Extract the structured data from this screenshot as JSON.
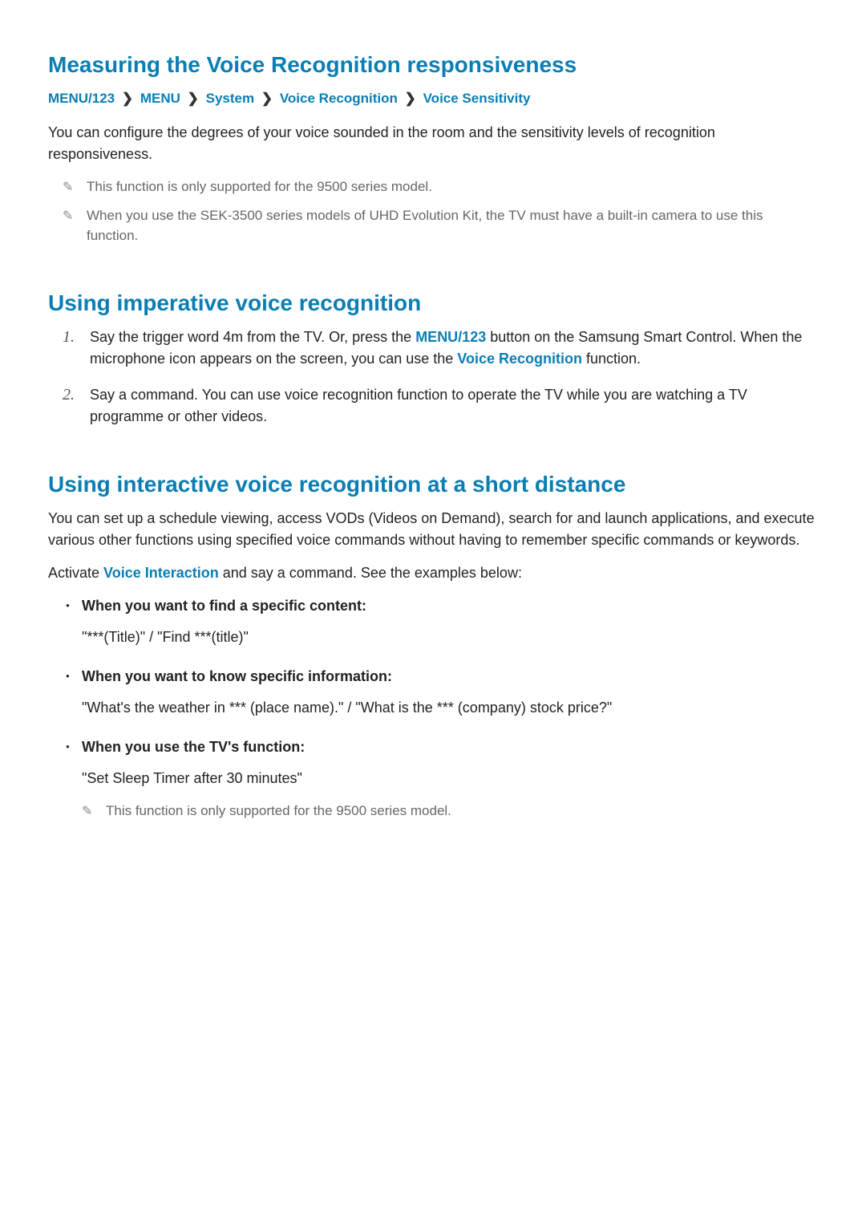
{
  "section1": {
    "title": "Measuring the Voice Recognition responsiveness",
    "breadcrumb": [
      "MENU/123",
      "MENU",
      "System",
      "Voice Recognition",
      "Voice Sensitivity"
    ],
    "intro": "You can configure the degrees of your voice sounded in the room and the sensitivity levels of recognition responsiveness.",
    "notes": [
      "This function is only supported for the 9500 series model.",
      "When you use the SEK-3500 series models of UHD Evolution Kit, the TV must have a built-in camera to use this function."
    ]
  },
  "section2": {
    "title": "Using imperative voice recognition",
    "steps": [
      {
        "num": "1.",
        "pre": "Say the trigger word 4m from the TV. Or, press the ",
        "link1": "MENU/123",
        "mid": " button on the Samsung Smart Control. When the microphone icon appears on the screen, you can use the ",
        "link2": "Voice Recognition",
        "post": " function."
      },
      {
        "num": "2.",
        "text": "Say a command. You can use voice recognition function to operate the TV while you are watching a TV programme or other videos."
      }
    ]
  },
  "section3": {
    "title": "Using interactive voice recognition at a short distance",
    "intro": "You can set up a schedule viewing, access VODs (Videos on Demand), search for and launch applications, and execute various other functions using specified voice commands without having to remember specific commands or keywords.",
    "activate_pre": "Activate ",
    "activate_link": "Voice Interaction",
    "activate_post": " and say a command. See the examples below:",
    "bullets": [
      {
        "title": "When you want to find a specific content:",
        "example": "\"***(Title)\" / \"Find ***(title)\""
      },
      {
        "title": "When you want to know specific information:",
        "example": "\"What's the weather in *** (place name).\" / \"What is the *** (company) stock price?\""
      },
      {
        "title": "When you use the TV's function:",
        "example": "\"Set Sleep Timer after 30 minutes\"",
        "note": "This function is only supported for the 9500 series model."
      }
    ]
  }
}
